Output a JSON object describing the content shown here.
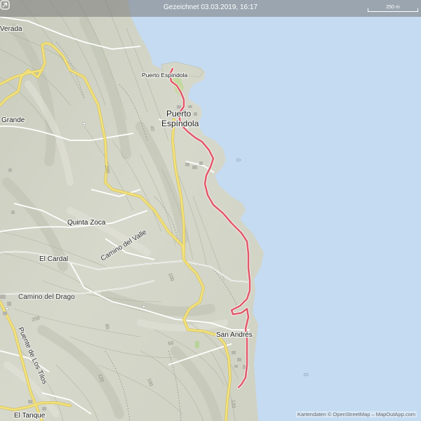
{
  "header": {
    "title": "Gezeichnet 03.03.2019, 16:17",
    "scale_label": "250 m"
  },
  "labels": {
    "puerto_espindola_small": "Puerto Espíndola",
    "puerto_line1": "Puerto",
    "puerto_line2": "Espíndola",
    "la_verada": "La Verada",
    "grande": "Grande",
    "quinta_zoca": "Quinta Zoca",
    "el_cardal": "El Cardal",
    "camino_del_valle": "Camino del Valle",
    "camino_del_drago": "Camino del Drago",
    "puente_de_los_tilos": "Puente de Los Tilos",
    "san_andres": "San Andrés",
    "el_tanque": "El Tanque"
  },
  "contours": {
    "c200": "200",
    "c100": "100",
    "c40": "40",
    "c60": "60",
    "c120": "120",
    "c80": "80",
    "c100b": "100",
    "c120b": "120",
    "c200b": "200"
  },
  "attribution": "Kartendaten © OpenStreetMap – MapOutApp.com",
  "colors": {
    "sea": "#c4dbf2",
    "land": "#d4d6c8",
    "road_yellow": "#f2e27a",
    "road_outline": "#d8c468",
    "track": "#e05a6a"
  },
  "icons": {
    "export": "export-icon"
  }
}
